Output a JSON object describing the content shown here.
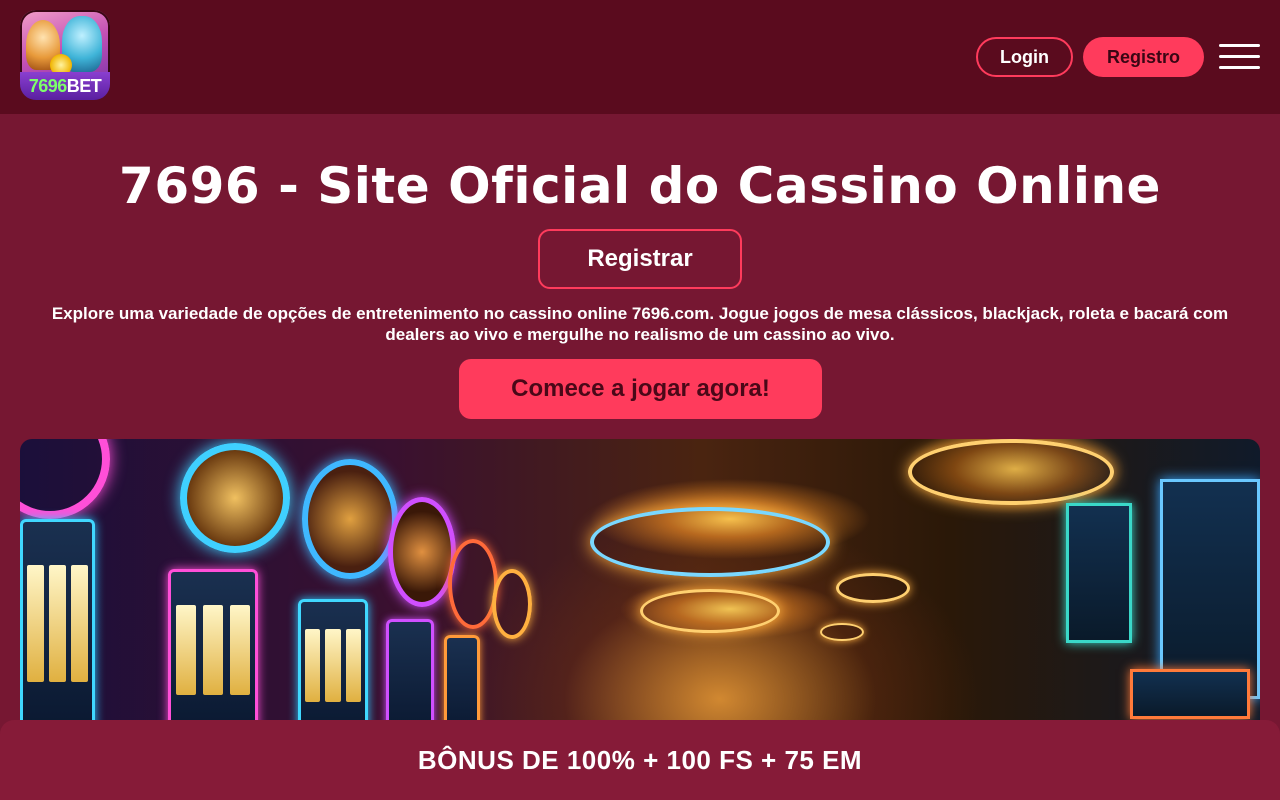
{
  "header": {
    "logo": {
      "brand_number": "7696",
      "brand_suffix": "BET",
      "icon": "casino-mascot-logo"
    },
    "login_label": "Login",
    "register_label": "Registro",
    "menu_icon": "hamburger-menu-icon"
  },
  "main": {
    "title": "7696 - Site Oficial do Cassino Online",
    "register_button": "Registrar",
    "description": "Explore uma variedade de opções de entretenimento no cassino online 7696.com. Jogue jogos de mesa clássicos, blackjack, roleta e bacará com dealers ao vivo e mergulhe no realismo de um cassino ao vivo.",
    "cta_button": "Comece a jogar agora!"
  },
  "hero_image": {
    "subject": "neon-casino-interior"
  },
  "bonus_bar": {
    "text": "BÔNUS DE 100% + 100 FS + 75 EM"
  },
  "colors": {
    "header_bg": "#5a0b1e",
    "page_bg": "#761732",
    "accent": "#ff3b5c",
    "bonus_bg": "#861b38"
  }
}
